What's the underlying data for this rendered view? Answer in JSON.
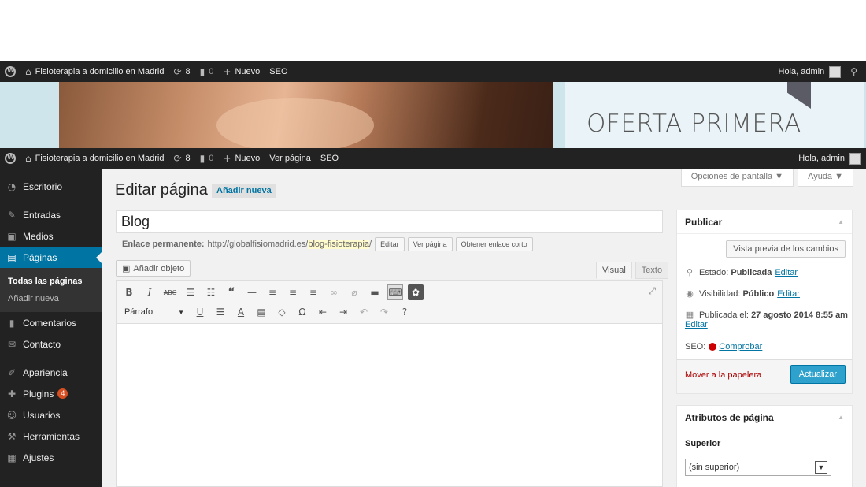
{
  "admin_bar_top": {
    "site_name": "Fisioterapia a domicilio en Madrid",
    "updates_count": "8",
    "comments_count": "0",
    "new_label": "Nuevo",
    "seo_label": "SEO",
    "greeting": "Hola, admin"
  },
  "banner": {
    "offer_text": "OFERTA PRIMERA"
  },
  "admin_bar": {
    "site_name": "Fisioterapia a domicilio en Madrid",
    "updates_count": "8",
    "comments_count": "0",
    "new_label": "Nuevo",
    "view_page_label": "Ver página",
    "seo_label": "SEO",
    "greeting": "Hola, admin"
  },
  "sidebar": {
    "items": [
      {
        "label": "Escritorio",
        "icon": "dashboard-icon"
      },
      {
        "label": "Entradas",
        "icon": "pin-icon"
      },
      {
        "label": "Medios",
        "icon": "media-icon"
      },
      {
        "label": "Páginas",
        "icon": "pages-icon"
      },
      {
        "label": "Comentarios",
        "icon": "comment-icon"
      },
      {
        "label": "Contacto",
        "icon": "contact-icon"
      },
      {
        "label": "Apariencia",
        "icon": "appearance-icon"
      },
      {
        "label": "Plugins",
        "icon": "plugin-icon",
        "badge": "4"
      },
      {
        "label": "Usuarios",
        "icon": "users-icon"
      },
      {
        "label": "Herramientas",
        "icon": "tools-icon"
      },
      {
        "label": "Ajustes",
        "icon": "settings-icon"
      }
    ],
    "submenu": {
      "all_pages": "Todas las páginas",
      "add_new": "Añadir nueva"
    }
  },
  "header": {
    "screen_options": "Opciones de pantalla ▼",
    "help": "Ayuda ▼",
    "title": "Editar página",
    "add_new": "Añadir nueva"
  },
  "editor": {
    "post_title": "Blog",
    "permalink_label": "Enlace permanente:",
    "permalink_base": "http://globalfisiomadrid.es/",
    "permalink_slug": "blog-fisioterapia",
    "permalink_end": "/",
    "edit_btn": "Editar",
    "view_page_btn": "Ver página",
    "short_link_btn": "Obtener enlace corto",
    "add_media": "Añadir objeto",
    "tab_visual": "Visual",
    "tab_text": "Texto",
    "format_select": "Párrafo"
  },
  "publish": {
    "title": "Publicar",
    "preview_btn": "Vista previa de los cambios",
    "status_label": "Estado:",
    "status_value": "Publicada",
    "status_edit": "Editar",
    "visibility_label": "Visibilidad:",
    "visibility_value": "Público",
    "visibility_edit": "Editar",
    "published_label": "Publicada el:",
    "published_value": "27 agosto 2014 8:55 am",
    "published_edit": "Editar",
    "seo_label": "SEO:",
    "seo_check": "Comprobar",
    "trash": "Mover a la papelera",
    "update_btn": "Actualizar"
  },
  "attributes": {
    "title": "Atributos de página",
    "parent_label": "Superior",
    "parent_value": "(sin superior)"
  }
}
